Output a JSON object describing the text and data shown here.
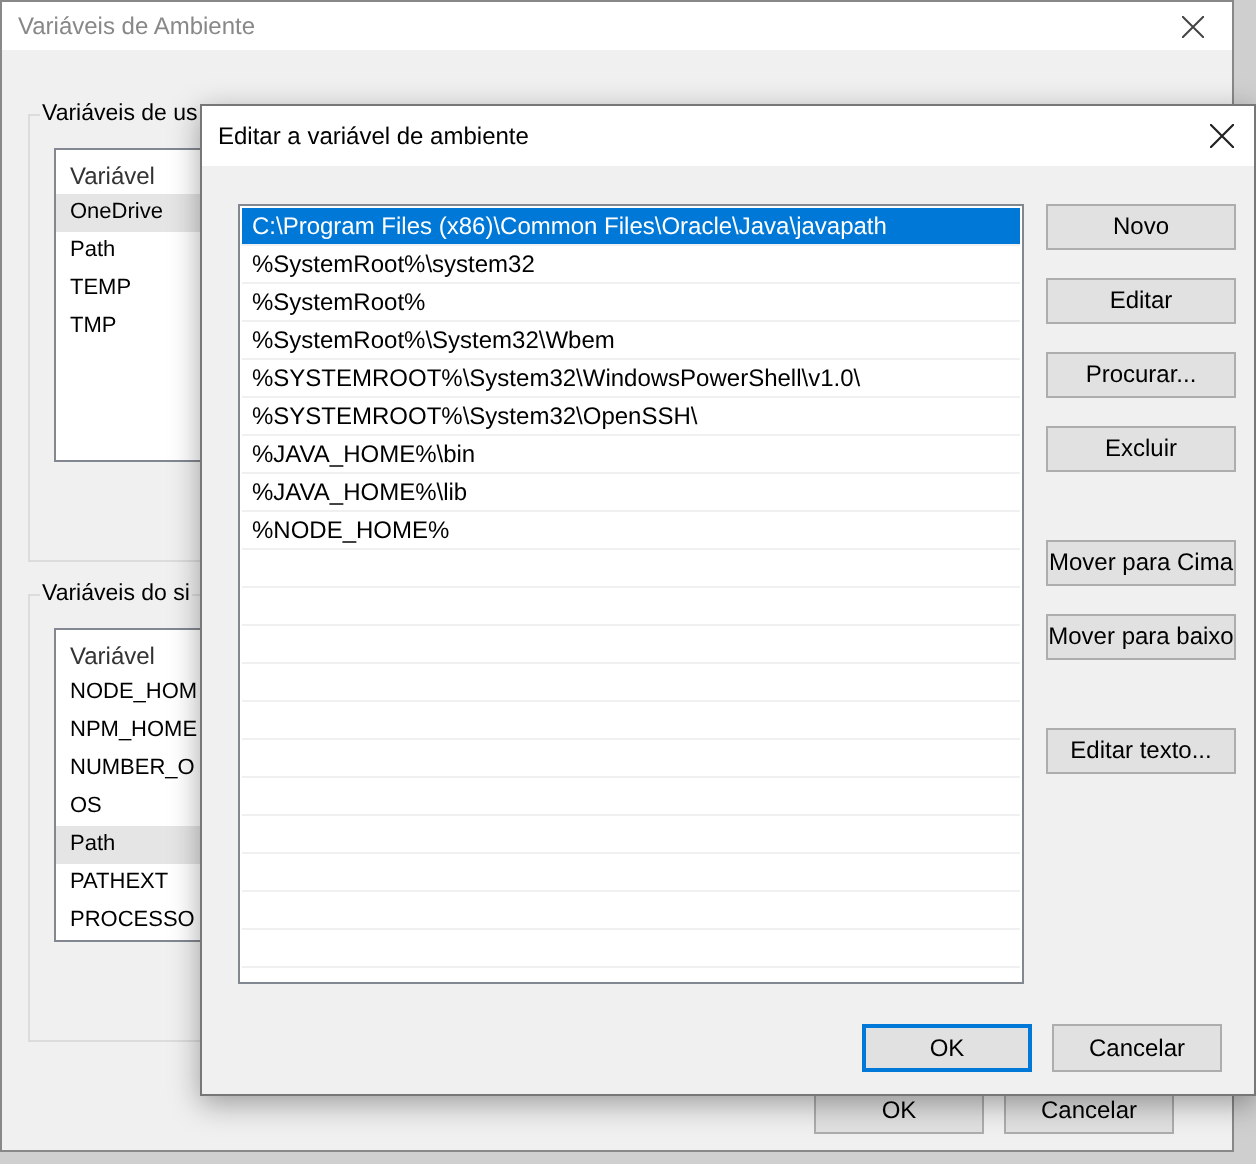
{
  "background_window": {
    "title": "Variáveis de Ambiente",
    "groups": [
      {
        "label": "Variáveis de us",
        "column": "Variável",
        "rows": [
          {
            "name": "OneDrive",
            "selected": true
          },
          {
            "name": "Path",
            "selected": false
          },
          {
            "name": "TEMP",
            "selected": false
          },
          {
            "name": "TMP",
            "selected": false
          }
        ]
      },
      {
        "label": "Variáveis do si",
        "column": "Variável",
        "rows": [
          {
            "name": "NODE_HOM",
            "selected": false
          },
          {
            "name": "NPM_HOME",
            "selected": false
          },
          {
            "name": "NUMBER_O",
            "selected": false
          },
          {
            "name": "OS",
            "selected": false
          },
          {
            "name": "Path",
            "selected": true
          },
          {
            "name": "PATHEXT",
            "selected": false
          },
          {
            "name": "PROCESSO",
            "selected": false
          }
        ]
      }
    ],
    "buttons": [
      "OK",
      "Cancelar"
    ]
  },
  "dialog": {
    "title": "Editar a variável de ambiente",
    "entries": [
      {
        "text": "C:\\Program Files (x86)\\Common Files\\Oracle\\Java\\javapath",
        "selected": true
      },
      {
        "text": "%SystemRoot%\\system32",
        "selected": false
      },
      {
        "text": "%SystemRoot%",
        "selected": false
      },
      {
        "text": "%SystemRoot%\\System32\\Wbem",
        "selected": false
      },
      {
        "text": "%SYSTEMROOT%\\System32\\WindowsPowerShell\\v1.0\\",
        "selected": false
      },
      {
        "text": "%SYSTEMROOT%\\System32\\OpenSSH\\",
        "selected": false
      },
      {
        "text": "%JAVA_HOME%\\bin",
        "selected": false
      },
      {
        "text": "%JAVA_HOME%\\lib",
        "selected": false
      },
      {
        "text": "%NODE_HOME%",
        "selected": false
      }
    ],
    "side_button_groups": [
      [
        "Novo",
        "Editar",
        "Procurar...",
        "Excluir"
      ],
      [
        "Mover para Cima",
        "Mover para baixo"
      ],
      [
        "Editar texto..."
      ]
    ],
    "buttons": [
      {
        "label": "OK",
        "default": true
      },
      {
        "label": "Cancelar",
        "default": false
      }
    ]
  }
}
